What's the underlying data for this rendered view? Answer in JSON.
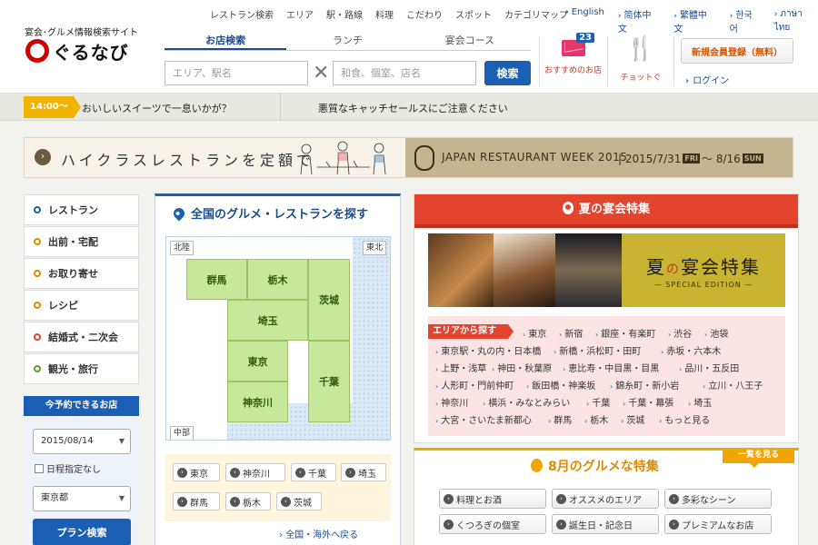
{
  "header": {
    "tagline": "宴会･グルメ情報検索サイト",
    "logo_text": "ぐるなび",
    "topnav": [
      "レストラン検索",
      "エリア",
      "駅・路線",
      "料理",
      "こだわり",
      "スポット",
      "カテゴリマップ"
    ],
    "languages": [
      "English",
      "简体中文",
      "繁體中文",
      "한국어",
      "ภาษาไทย"
    ],
    "search_tabs": [
      "お店検索",
      "ランチ",
      "宴会コース"
    ],
    "area_placeholder": "エリア、駅名",
    "keyword_placeholder": "和食、個室、店名",
    "search_button": "検索",
    "mail_badge": "23",
    "mail_label": "おすすめのお店",
    "chotto_label": "チョットぐ",
    "register_button": "新規会員登録（無料）",
    "login_label": "ログイン"
  },
  "notice": {
    "time": "14:00〜",
    "message1": "おいしいスイーツで一息いかが？",
    "message2": "悪質なキャッチセールスにご注意ください"
  },
  "banner": {
    "left_text": "ハイクラスレストランを定額で",
    "event_name": "JAPAN RESTAURANT WEEK 2015",
    "start_date": "2015/7/31",
    "start_day": "FRI",
    "end_date": "8/16",
    "end_day": "SUN"
  },
  "sidebar": {
    "items": [
      {
        "label": "レストラン",
        "color": "#1a5fb4"
      },
      {
        "label": "出前・宅配",
        "color": "#e08a00"
      },
      {
        "label": "お取り寄せ",
        "color": "#e08a00"
      },
      {
        "label": "レシピ",
        "color": "#e08a00"
      },
      {
        "label": "結婚式・二次会",
        "color": "#e4432d"
      },
      {
        "label": "観光・旅行",
        "color": "#5aa02c"
      }
    ],
    "availability": {
      "title": "今予約できるお店",
      "date": "2015/08/14",
      "no_date_label": "日程指定なし",
      "area": "東京都",
      "button": "プラン検索"
    }
  },
  "map_panel": {
    "title": "全国のグルメ・レストランを探す",
    "region_north": "北陸",
    "region_northeast": "東北",
    "region_central": "中部",
    "prefectures": [
      "群馬",
      "栃木",
      "茨城",
      "埼玉",
      "東京",
      "千葉",
      "神奈川"
    ],
    "pref_links": [
      "東京",
      "神奈川",
      "千葉",
      "埼玉",
      "群馬",
      "栃木",
      "茨城"
    ],
    "more_link": "全国・海外へ戻る"
  },
  "summer": {
    "title": "夏の宴会特集",
    "feature_title_a": "夏",
    "feature_title_b": "の",
    "feature_title_c": "宴会特集",
    "feature_sub": "— SPECIAL EDITION —",
    "area_tag": "エリアから探す",
    "area_links": [
      "東京",
      "新宿",
      "銀座・有楽町",
      "渋谷",
      "池袋",
      "東京駅・丸の内・日本橋",
      "新橋・浜松町・田町",
      "赤坂・六本木",
      "上野・浅草",
      "神田・秋葉原",
      "恵比寿・中目黒・目黒",
      "品川・五反田",
      "人形町・門前仲町",
      "飯田橋・神楽坂",
      "錦糸町・新小岩",
      "立川・八王子",
      "神奈川",
      "横浜・みなとみらい",
      "千葉",
      "千葉・幕張",
      "埼玉",
      "大宮・さいたま新都心",
      "群馬",
      "栃木",
      "茨城",
      "もっと見る"
    ]
  },
  "august": {
    "title": "8月のグルメな特集",
    "more": "一覧を見る",
    "buttons": [
      "料理とお酒",
      "オススメのエリア",
      "多彩なシーン",
      "くつろぎの個室",
      "誕生日・記念日",
      "プレミアムなお店"
    ]
  }
}
